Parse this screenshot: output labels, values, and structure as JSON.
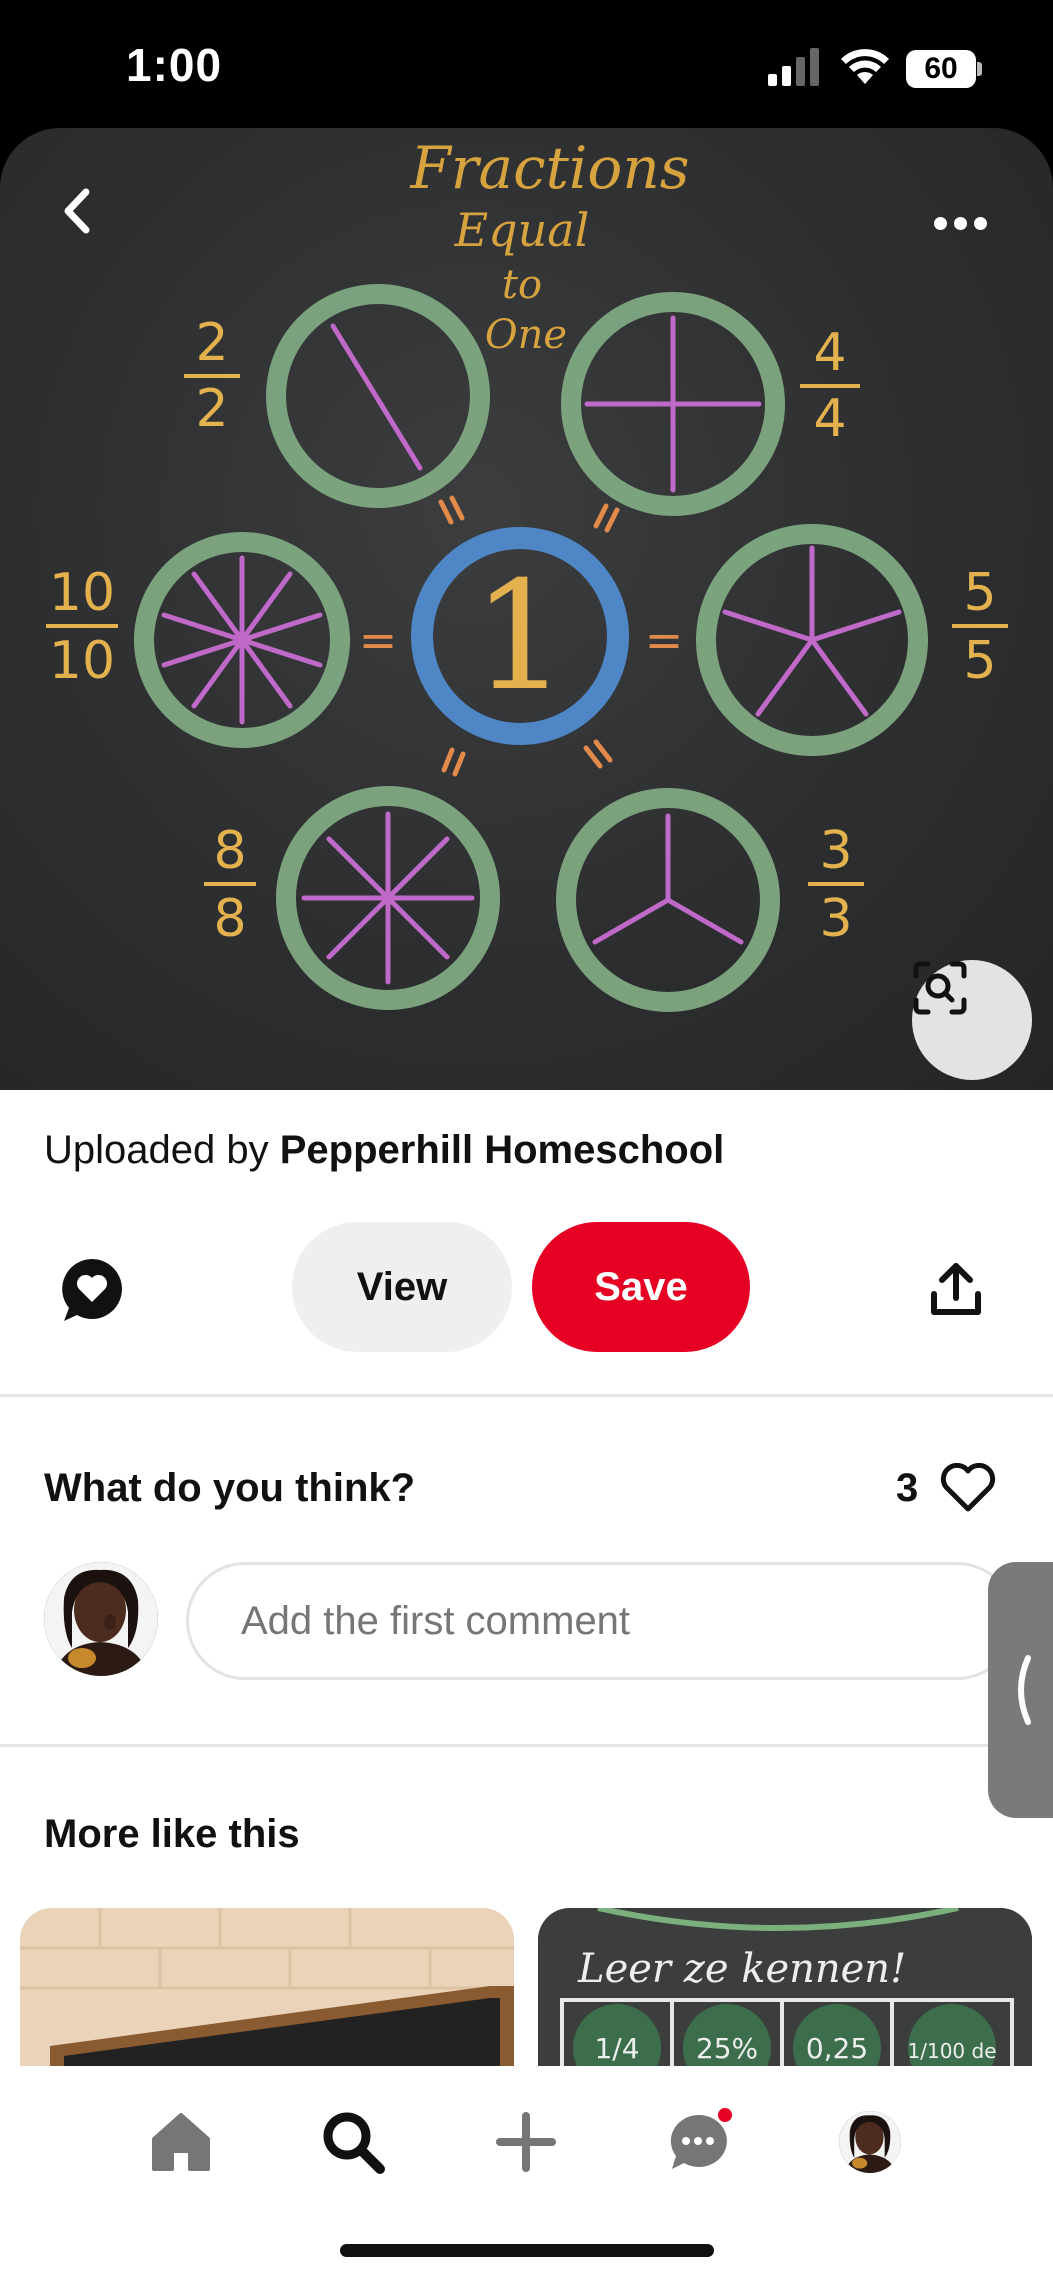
{
  "status_bar": {
    "time": "1:00",
    "battery": "60",
    "icons": [
      "signal-icon",
      "wifi-icon",
      "battery-icon"
    ]
  },
  "pin_image": {
    "alt": "Chalkboard drawing of fraction circles",
    "board_text": {
      "title_line1": "Fractions",
      "title_line2": "Equal",
      "title_line3": "to",
      "title_line4": "One",
      "center": "1",
      "fractions": [
        {
          "num": "2",
          "den": "2"
        },
        {
          "num": "4",
          "den": "4"
        },
        {
          "num": "10",
          "den": "10"
        },
        {
          "num": "5",
          "den": "5"
        },
        {
          "num": "8",
          "den": "8"
        },
        {
          "num": "3",
          "den": "3"
        }
      ],
      "equals": "="
    },
    "icons": [
      "back-chevron-icon",
      "more-options-icon",
      "visual-search-icon"
    ]
  },
  "uploader": {
    "prefix": "Uploaded by ",
    "name": "Pepperhill Homeschool"
  },
  "actions": {
    "view_label": "View",
    "save_label": "Save",
    "save_color": "#e60023"
  },
  "comments": {
    "title": "What do you think?",
    "reaction_count": "3",
    "input_placeholder": "Add the first comment"
  },
  "more_like_this": {
    "title": "More like this",
    "cards": [
      {
        "name": "related-pin-1"
      },
      {
        "name": "related-pin-2",
        "visible_text": "Leer ze kennen!",
        "cells": [
          "1/4",
          "25%",
          "0,25",
          "1/100 de"
        ]
      }
    ]
  },
  "bottom_nav": {
    "items": [
      "home-icon",
      "search-icon",
      "create-plus-icon",
      "messages-icon",
      "profile-avatar"
    ],
    "active": "search-icon"
  }
}
